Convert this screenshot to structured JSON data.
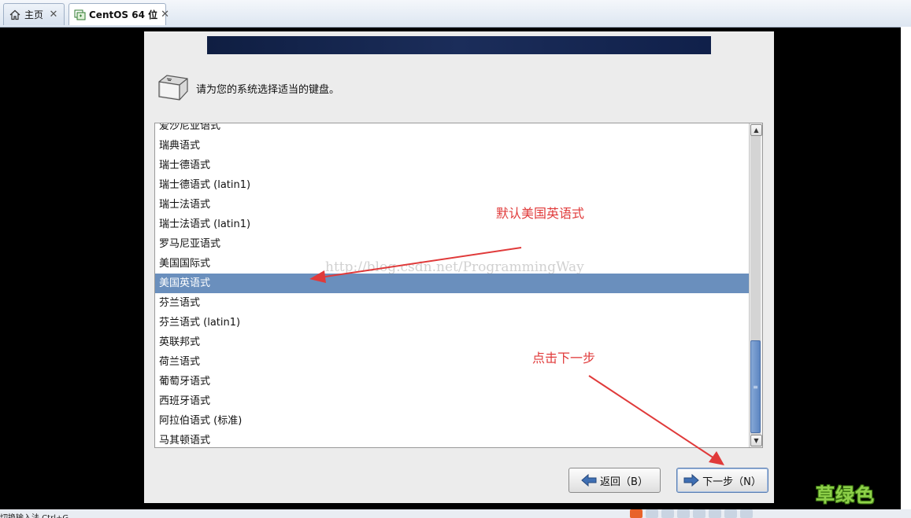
{
  "tabs": [
    {
      "label": "主页",
      "icon": "home-icon",
      "active": false
    },
    {
      "label": "CentOS 64 位",
      "icon": "vm-icon",
      "active": true
    }
  ],
  "installer": {
    "prompt": "请为您的系统选择适当的键盘。",
    "keyboard_layouts": [
      "爱沙尼亚语式",
      "瑞典语式",
      "瑞士德语式",
      "瑞士德语式 (latin1)",
      "瑞士法语式",
      "瑞士法语式 (latin1)",
      "罗马尼亚语式",
      "美国国际式",
      "美国英语式",
      "芬兰语式",
      "芬兰语式 (latin1)",
      "英联邦式",
      "荷兰语式",
      "葡萄牙语式",
      "西班牙语式",
      "阿拉伯语式 (标准)",
      "马其顿语式"
    ],
    "selected_layout": "美国英语式",
    "back_button": "返回（B）",
    "next_button": "下一步（N）"
  },
  "annotations": {
    "default_note": "默认美国英语式",
    "next_note": "点击下一步",
    "watermark": "http://blog.csdn.net/ProgrammingWay"
  },
  "taskbar": {
    "status_text": "切换输入法 Ctrl+G",
    "signature": "草绿色"
  },
  "colors": {
    "selection": "#6a8fbd",
    "annotation": "#e03a3a",
    "signature": "#8fd14a"
  }
}
